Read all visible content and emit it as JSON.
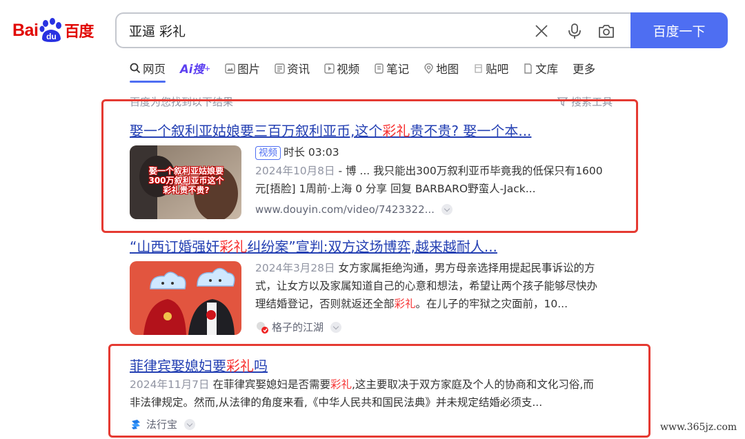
{
  "brand": {
    "logo_latin": "Bai",
    "logo_badge": "du",
    "logo_cn": "百度",
    "accent": "#4e6ef2",
    "red": "#e10602"
  },
  "search": {
    "query": "亚逼 彩礼",
    "button": "百度一下"
  },
  "tabs": [
    {
      "label": "网页",
      "icon": "search-icon"
    },
    {
      "label": "Ai搜",
      "icon": ""
    },
    {
      "label": "图片",
      "icon": "image-icon"
    },
    {
      "label": "资讯",
      "icon": "news-icon"
    },
    {
      "label": "视频",
      "icon": "play-icon"
    },
    {
      "label": "笔记",
      "icon": "note-icon"
    },
    {
      "label": "地图",
      "icon": "map-icon"
    },
    {
      "label": "贴吧",
      "icon": "tieba-icon"
    },
    {
      "label": "文库",
      "icon": "doc-icon"
    },
    {
      "label": "更多",
      "icon": ""
    }
  ],
  "summary": {
    "count_text": "百度为您找到以下结果",
    "tools": "搜索工具"
  },
  "results": [
    {
      "title_pre": "娶一个叙利亚姑娘要三百万叙利亚币,这个",
      "title_hl": "彩礼",
      "title_post": "贵不贵? 娶一个本...",
      "thumb_caption": "娶一个叙利亚姑娘要300万叙利亚币这个彩礼贵不贵?",
      "tag": "视频",
      "duration": "时长 03:03",
      "date": "2024年10月8日",
      "abstract_1": " - 博 ... 我只能出300万叙利亚币毕竟我的低保只有1600",
      "abstract_2": "元[捂脸] 1周前·上海 0 分享 回复 BARBARO野蛮人-Jack...",
      "source": "www.douyin.com/video/7423322..."
    },
    {
      "title_pre": "“山西订婚强奸",
      "title_hl": "彩礼",
      "title_post": "纠纷案”宣判:双方这场博弈,越来越耐人...",
      "date": "2024年3月28日",
      "abstract_1": " 女方家属拒绝沟通，男方母亲选择用提起民事诉讼的方",
      "abstract_2": "式，让女方以及家属知道自己的心意和想法，希望让两个孩子能够尽快办",
      "abstract_3_pre": "理结婚登记，否则就返还全部",
      "abstract_3_hl": "彩礼",
      "abstract_3_post": "。在儿子的牢狱之灾面前，10...",
      "source": "格子的江湖"
    },
    {
      "title_pre": "菲律宾娶媳妇要",
      "title_hl": "彩礼",
      "title_post": "吗",
      "date": "2024年11月7日",
      "abstract_1_pre": " 在菲律宾娶媳妇是否需要",
      "abstract_1_hl": "彩礼",
      "abstract_1_post": ",这主要取决于双方家庭及个人的协商和文化习俗,而",
      "abstract_2": "非法律规定。然而,从法律的角度来看,《中华人民共和国民法典》并未规定结婚必须支...",
      "source": "法行宝"
    }
  ],
  "watermark": "www.365jz.com"
}
